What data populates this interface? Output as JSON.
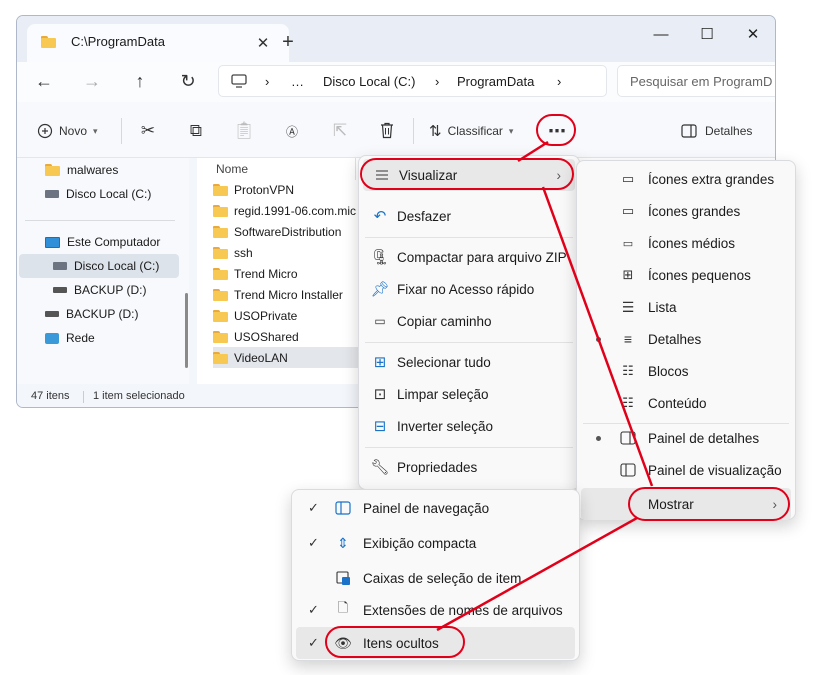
{
  "window": {
    "tab_title": "C:\\ProgramData",
    "tab_close": "✕",
    "new_tab": "+",
    "controls": {
      "minimize": "—",
      "maximize": "☐",
      "close": "✕"
    }
  },
  "navbar": {
    "back": "←",
    "forward": "→",
    "up": "↑",
    "refresh": "↻",
    "breadcrumb": [
      "…",
      "Disco Local (C:)",
      "ProgramData"
    ],
    "chevron": "›",
    "search_placeholder": "Pesquisar em ProgramD"
  },
  "commandbar": {
    "new_label": "Novo",
    "sort_label": "Classificar",
    "see_more": "⋯",
    "details_label": "Detalhes"
  },
  "navpane": {
    "items": [
      {
        "label": "malwares",
        "icon": "folder-icon"
      },
      {
        "label": "Disco Local (C:)",
        "icon": "drive-icon"
      },
      {
        "label": "Este Computador",
        "icon": "computer-icon"
      },
      {
        "label": "Disco Local (C:)",
        "icon": "drive-icon"
      },
      {
        "label": "BACKUP (D:)",
        "icon": "drive-icon"
      },
      {
        "label": "BACKUP (D:)",
        "icon": "drive-icon"
      },
      {
        "label": "Rede",
        "icon": "network-icon"
      }
    ]
  },
  "files": {
    "column_name": "Nome",
    "rows": [
      "ProtonVPN",
      "regid.1991-06.com.mic",
      "SoftwareDistribution",
      "ssh",
      "Trend Micro",
      "Trend Micro Installer",
      "USOPrivate",
      "USOShared",
      "VideoLAN"
    ],
    "selected": "VideoLAN"
  },
  "status": {
    "count": "47 itens",
    "selection": "1 item selecionado"
  },
  "context_menu": {
    "items": [
      {
        "label": "Visualizar",
        "icon": "view-icon",
        "submenu": true
      },
      {
        "label": "Desfazer",
        "icon": "undo-icon"
      },
      {
        "label": "Compactar para arquivo ZIP",
        "icon": "zip-icon"
      },
      {
        "label": "Fixar no Acesso rápido",
        "icon": "pin-icon"
      },
      {
        "label": "Copiar caminho",
        "icon": "copy-path-icon"
      },
      {
        "label": "Selecionar tudo",
        "icon": "select-all-icon"
      },
      {
        "label": "Limpar seleção",
        "icon": "clear-selection-icon"
      },
      {
        "label": "Inverter seleção",
        "icon": "invert-selection-icon"
      },
      {
        "label": "Propriedades",
        "icon": "properties-icon"
      }
    ]
  },
  "view_submenu": {
    "items": [
      {
        "label": "Ícones extra grandes",
        "icon": "monitor-icon"
      },
      {
        "label": "Ícones grandes",
        "icon": "monitor-icon"
      },
      {
        "label": "Ícones médios",
        "icon": "monitor-icon"
      },
      {
        "label": "Ícones pequenos",
        "icon": "grid-icon"
      },
      {
        "label": "Lista",
        "icon": "list-icon"
      },
      {
        "label": "Detalhes",
        "icon": "details-icon",
        "selected": true
      },
      {
        "label": "Blocos",
        "icon": "tiles-icon"
      },
      {
        "label": "Conteúdo",
        "icon": "content-icon"
      },
      {
        "label": "Painel de detalhes",
        "icon": "details-pane-icon",
        "selected": true
      },
      {
        "label": "Painel de visualização",
        "icon": "preview-pane-icon"
      },
      {
        "label": "Mostrar",
        "icon": "",
        "submenu": true
      }
    ]
  },
  "show_submenu": {
    "items": [
      {
        "label": "Painel de navegação",
        "checked": true,
        "icon": "nav-pane-icon"
      },
      {
        "label": "Exibição compacta",
        "checked": true,
        "icon": "compact-icon"
      },
      {
        "label": "Caixas de seleção de item",
        "checked": false,
        "icon": "checkbox-icon"
      },
      {
        "label": "Extensões de nomes de arquivos",
        "checked": true,
        "icon": "file-ext-icon"
      },
      {
        "label": "Itens ocultos",
        "checked": true,
        "icon": "eye-icon"
      }
    ],
    "check_glyph": "✓"
  },
  "colors": {
    "annotation_red": "#e1001a",
    "folder_yellow": "#f7c953"
  }
}
